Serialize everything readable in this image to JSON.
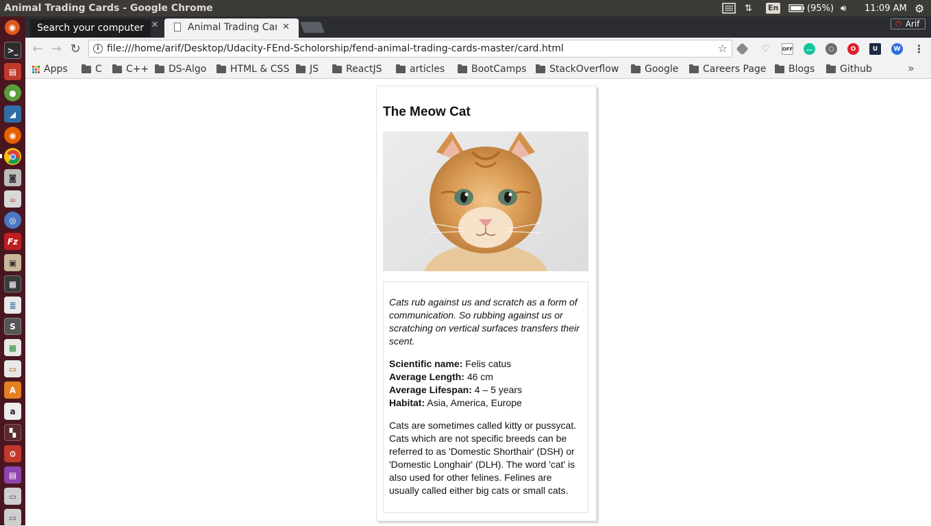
{
  "system": {
    "window_title": "Animal Trading Cards - Google Chrome",
    "language": "En",
    "battery": "(95%)",
    "clock": "11:09 AM"
  },
  "browser": {
    "tooltip": "Search your computer",
    "active_tab_title": "Animal Trading Cards",
    "profile_name": "Arif",
    "url": "file:///home/arif/Desktop/Udacity-FEnd-Scholorship/fend-animal-trading-cards-master/card.html",
    "bookmarks": {
      "apps": "Apps",
      "folders": [
        "C",
        "C++",
        "DS-Algo",
        "HTML & CSS",
        "JS",
        "ReactJS",
        "articles",
        "BootCamps",
        "StackOverflow",
        "Google",
        "Careers Page",
        "Blogs",
        "Github"
      ],
      "more": "»"
    }
  },
  "card": {
    "title": "The Meow Cat",
    "intro": "Cats rub against us and scratch as a form of communication. So rubbing against us or scratching on vertical surfaces transfers their scent.",
    "facts": [
      {
        "label": "Scientific name:",
        "value": "Felis catus"
      },
      {
        "label": "Average Length:",
        "value": "46 cm"
      },
      {
        "label": "Average Lifespan:",
        "value": "4 – 5 years"
      },
      {
        "label": "Habitat:",
        "value": "Asia, America, Europe"
      }
    ],
    "description": "Cats are sometimes called kitty or pussycat. Cats which are not specific breeds can be referred to as 'Domestic Shorthair' (DSH) or 'Domestic Longhair' (DLH). The word 'cat' is also used for other felines. Felines are usually called either big cats or small cats."
  },
  "colors": {
    "top_panel": "#3c3b37",
    "launcher": "#4a1721",
    "tab_strip": "#2b2d33",
    "toolbar": "#f2f2f2"
  }
}
